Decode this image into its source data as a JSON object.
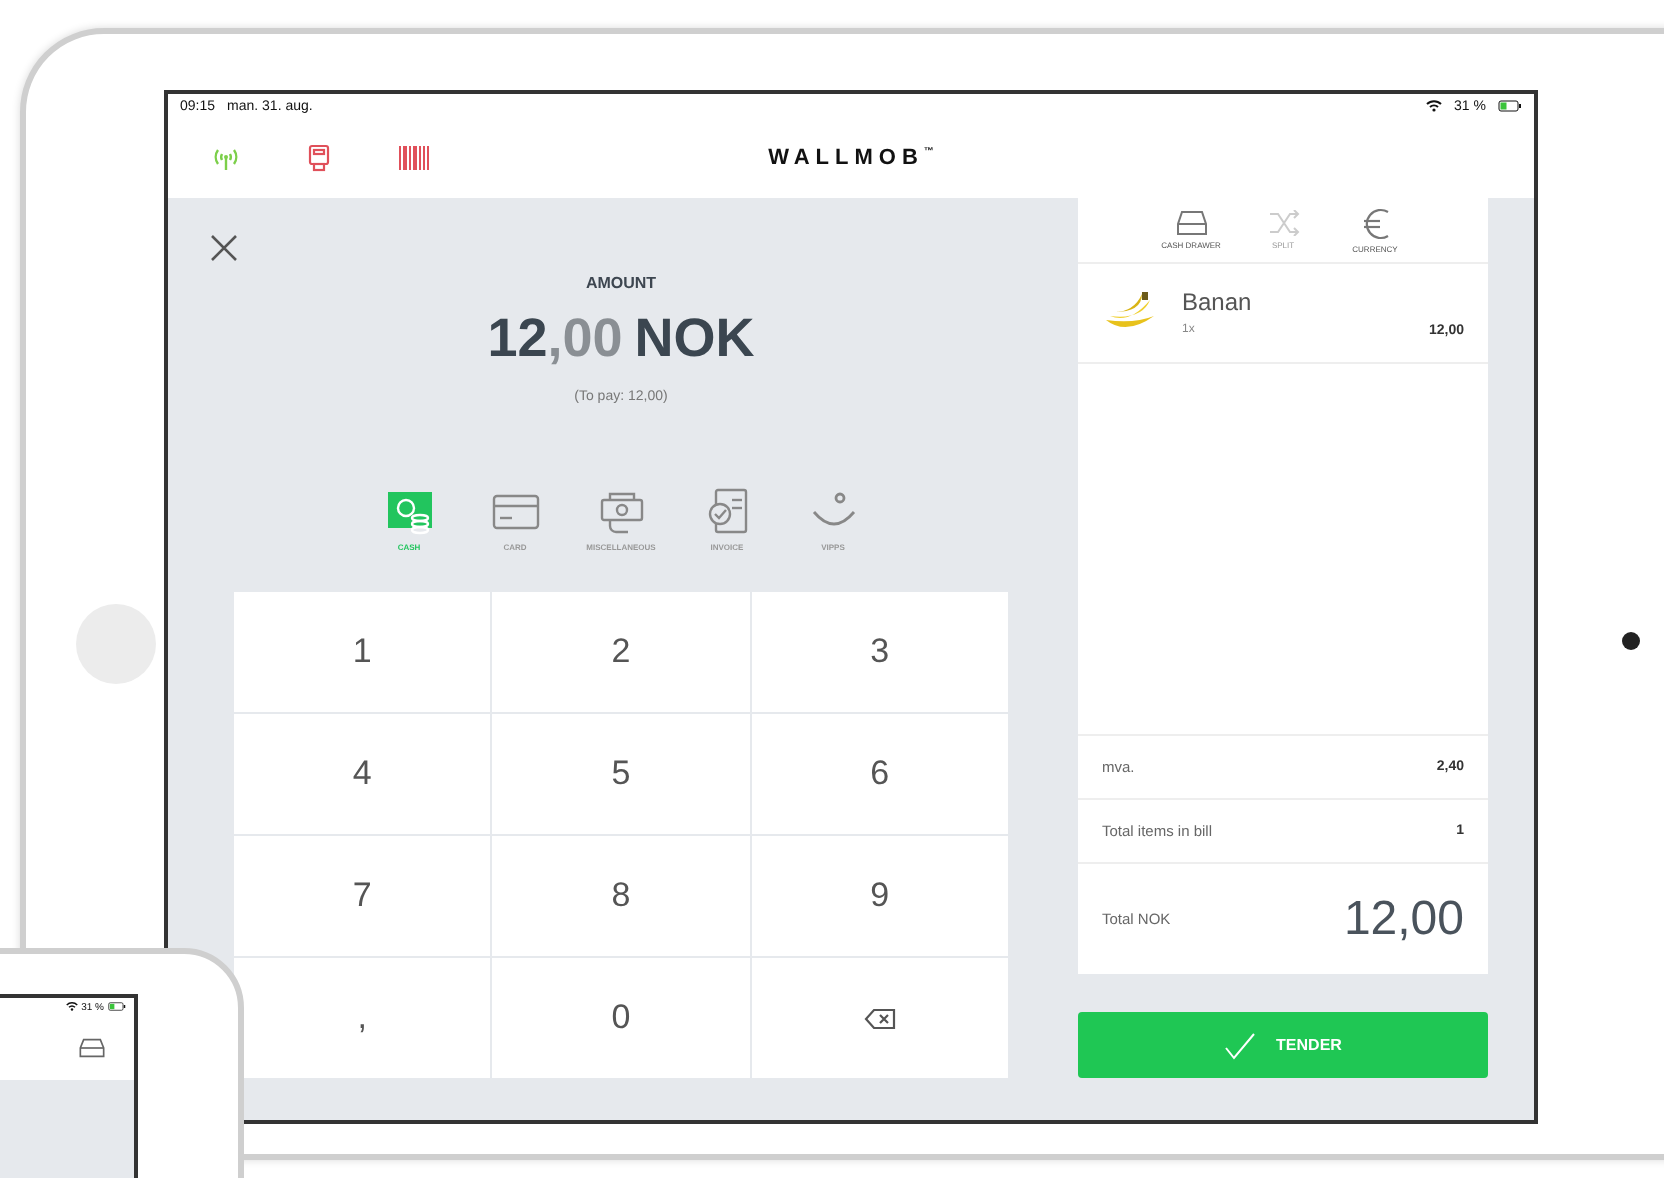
{
  "status_bar": {
    "time": "09:15",
    "date": "man. 31. aug.",
    "battery": "31 %"
  },
  "header": {
    "logo": "WALLMOB",
    "logo_mark": "™",
    "status_icons": [
      {
        "kind": "connection",
        "color": "#7ccf4a"
      },
      {
        "kind": "printer",
        "color": "#e0505a"
      },
      {
        "kind": "scanner",
        "color": "#e0505a"
      }
    ]
  },
  "amount": {
    "label": "AMOUNT",
    "whole": "12",
    "decimals": ",00",
    "currency": "NOK",
    "to_pay": "(To pay: 12,00)"
  },
  "payment_methods": [
    {
      "kind": "cash",
      "label": "CASH",
      "selected": true
    },
    {
      "kind": "card",
      "label": "CARD",
      "selected": false
    },
    {
      "kind": "misc",
      "label": "MISCELLANEOUS",
      "selected": false
    },
    {
      "kind": "invoice",
      "label": "INVOICE",
      "selected": false
    },
    {
      "kind": "vipps",
      "label": "VIPPS",
      "selected": false
    }
  ],
  "keypad": [
    {
      "kind": "digit",
      "label": "1"
    },
    {
      "kind": "digit",
      "label": "2"
    },
    {
      "kind": "digit",
      "label": "3"
    },
    {
      "kind": "digit",
      "label": "4"
    },
    {
      "kind": "digit",
      "label": "5"
    },
    {
      "kind": "digit",
      "label": "6"
    },
    {
      "kind": "digit",
      "label": "7"
    },
    {
      "kind": "digit",
      "label": "8"
    },
    {
      "kind": "digit",
      "label": "9"
    },
    {
      "kind": "digit",
      "label": ","
    },
    {
      "kind": "digit",
      "label": "0"
    },
    {
      "kind": "backspace"
    }
  ],
  "bill_tools": [
    {
      "kind": "drawer",
      "label": "CASH DRAWER",
      "disabled": false
    },
    {
      "kind": "split",
      "label": "SPLIT",
      "disabled": true
    },
    {
      "kind": "currency",
      "label": "CURRENCY",
      "disabled": false
    }
  ],
  "bill_items": [
    {
      "name": "Banan",
      "quantity": "1x",
      "price": "12,00"
    }
  ],
  "summary": [
    {
      "label": "mva.",
      "value": "2,40"
    },
    {
      "label": "Total items in bill",
      "value": "1"
    }
  ],
  "total": {
    "label": "Total NOK",
    "value": "12,00"
  },
  "tender": {
    "label": "TENDER"
  },
  "phone": {
    "battery": "31 %"
  }
}
